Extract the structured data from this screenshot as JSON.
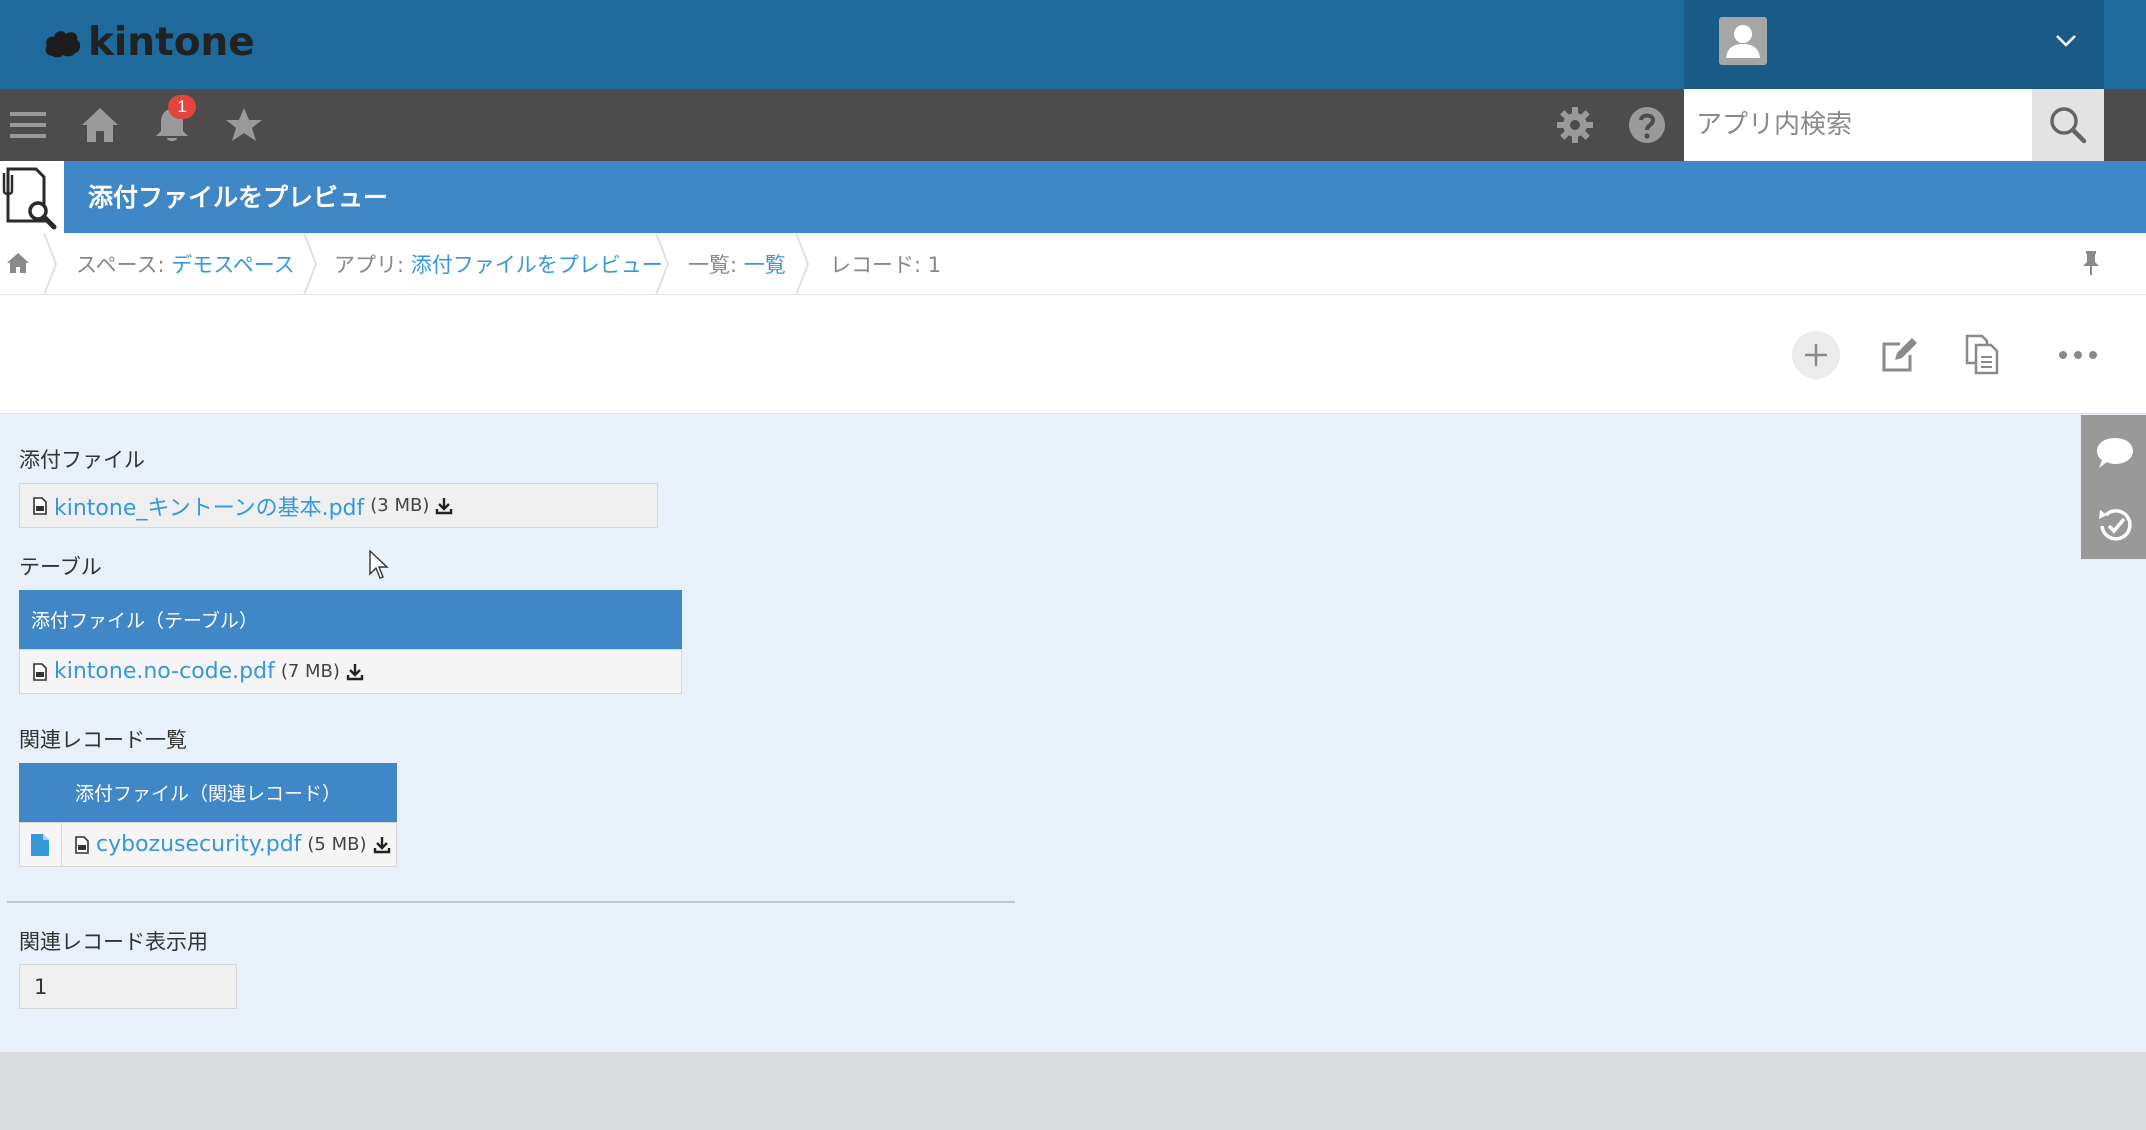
{
  "header": {
    "logo_text": "kintone",
    "brand_color": "#1e6a9c",
    "icons": [
      "cloud-logo-icon",
      "user-avatar-icon",
      "chevron-down-icon"
    ]
  },
  "toolbar": {
    "icons": [
      "menu-icon",
      "home-icon",
      "bell-icon",
      "star-icon",
      "gear-icon",
      "help-icon",
      "search-icon"
    ],
    "notification_count": "1",
    "search_placeholder": "アプリ内検索"
  },
  "app": {
    "title": "添付ファイルをプレビュー",
    "accent_color": "#3f87c6"
  },
  "breadcrumb": {
    "space_label": "スペース: ",
    "space_name": "デモスペース",
    "app_label": "アプリ: ",
    "app_name": "添付ファイルをプレビュー",
    "view_label": "一覧: ",
    "view_name": "一覧",
    "record_label": "レコード: 1"
  },
  "actions": [
    "add-icon",
    "edit-icon",
    "copy-icon",
    "more-icon"
  ],
  "record": {
    "attachment": {
      "label": "添付ファイル",
      "file_name": "kintone_キントーンの基本.pdf",
      "file_size": "(3 MB)"
    },
    "table": {
      "label": "テーブル",
      "header": "添付ファイル（テーブル）",
      "file_name": "kintone.no-code.pdf",
      "file_size": "(7 MB)"
    },
    "related": {
      "label": "関連レコード一覧",
      "header": "添付ファイル（関連レコード）",
      "file_name": "cybozusecurity.pdf",
      "file_size": "(5 MB)"
    },
    "related_display": {
      "label": "関連レコード表示用",
      "value": "1"
    }
  },
  "side_panel": [
    "comment-icon",
    "history-icon"
  ]
}
